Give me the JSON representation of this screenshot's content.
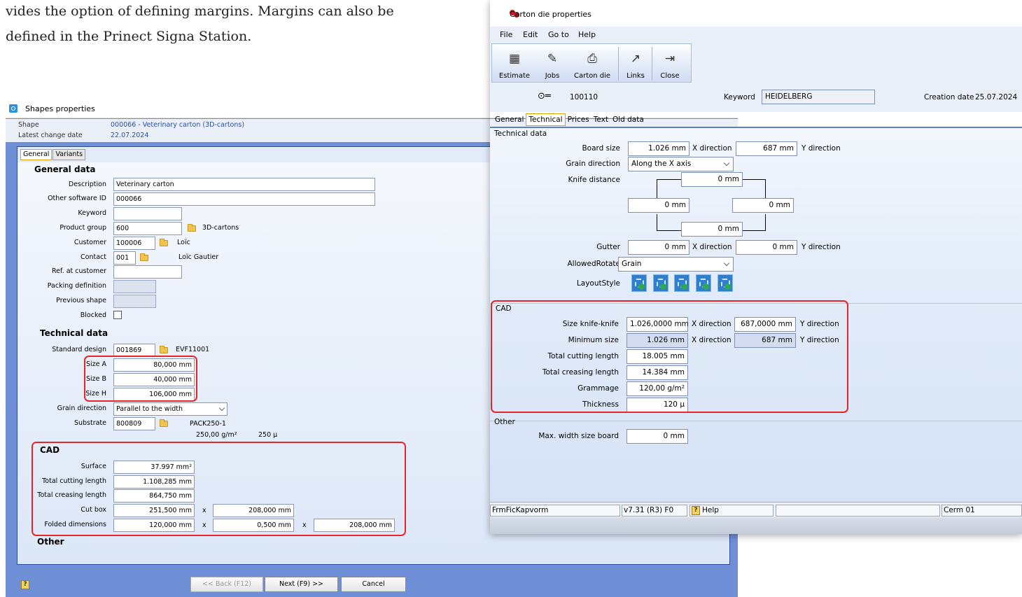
{
  "doc_text": {
    "line1": "vides the option of defining margins. Margins can also be",
    "line2": "defined in the Prinect Signa Station."
  },
  "shapes": {
    "title": "Shapes properties",
    "shape_label": "Shape",
    "shape_value": "000066 - Veterinary carton (3D-cartons)",
    "change_label": "Latest change date",
    "change_value": "22.07.2024",
    "tabs": [
      "General",
      "Variants"
    ],
    "general_heading": "General data",
    "description_label": "Description",
    "description_value": "Veterinary carton",
    "other_sw_label": "Other software ID",
    "other_sw_value": "000066",
    "keyword_label": "Keyword",
    "keyword_value": "",
    "product_group_label": "Product group",
    "product_group_value": "600",
    "product_group_name": "3D-cartons",
    "customer_label": "Customer",
    "customer_value": "100006",
    "customer_name": "Loïc",
    "contact_label": "Contact",
    "contact_value": "001",
    "contact_name": "Loïc Gautier",
    "ref_customer_label": "Ref. at customer",
    "packing_label": "Packing definition",
    "prev_shape_label": "Previous shape",
    "blocked_label": "Blocked",
    "technical_heading": "Technical data",
    "std_design_label": "Standard design",
    "std_design_value": "001869",
    "std_design_name": "EVF11001",
    "size_a_label": "Size A",
    "size_a_value": "80,000 mm",
    "size_b_label": "Size B",
    "size_b_value": "40,000 mm",
    "size_h_label": "Size H",
    "size_h_value": "106,000 mm",
    "grain_label": "Grain direction",
    "grain_value": "Parallel to the width",
    "substrate_label": "Substrate",
    "substrate_value": "800809",
    "substrate_name": "PACK250-1",
    "substrate_grammage": "250,00 g/m²",
    "substrate_thickness": "250 µ",
    "cad_heading": "CAD",
    "surface_label": "Surface",
    "surface_value": "37.997 mm²",
    "cutting_label": "Total cutting length",
    "cutting_value": "1.108,285 mm",
    "creasing_label": "Total creasing length",
    "creasing_value": "864,750 mm",
    "cutbox_label": "Cut box",
    "cutbox_x": "251,500 mm",
    "cutbox_y": "208,000 mm",
    "folded_label": "Folded dimensions",
    "folded_1": "120,000 mm",
    "folded_2": "0,500 mm",
    "folded_3": "208,000 mm",
    "times": "x",
    "other_heading": "Other",
    "help_glyph": "?",
    "back_button": "<< Back (F12)",
    "next_button": "Next (F9) >>",
    "cancel_button": "Cancel"
  },
  "carton": {
    "title": "Carton die properties",
    "menu": [
      "File",
      "Edit",
      "Go to",
      "Help"
    ],
    "toolbar": [
      {
        "label": "Estimate",
        "icon": "▦"
      },
      {
        "label": "Jobs",
        "icon": "✎"
      },
      {
        "label": "Carton die",
        "icon": "⎙"
      },
      {
        "label": "Links",
        "icon": "↗"
      },
      {
        "label": "Close",
        "icon": "⇥"
      }
    ],
    "key_glyph": "⊙═",
    "id_value": "100110",
    "keyword_label": "Keyword",
    "keyword_value": "HEIDELBERG",
    "creation_label": "Creation date",
    "creation_value": "25.07.2024",
    "tabs": [
      "General",
      "Technical",
      "Prices",
      "Text",
      "Old data"
    ],
    "technical_group": "Technical data",
    "board_size_label": "Board size",
    "board_x": "1.026 mm",
    "board_y": "687 mm",
    "x_direction": "X direction",
    "y_direction": "Y direction",
    "grain_label": "Grain direction",
    "grain_value": "Along the X axis",
    "knife_label": "Knife distance",
    "knife_top": "0 mm",
    "knife_left": "0 mm",
    "knife_right": "0 mm",
    "knife_bottom": "0 mm",
    "gutter_label": "Gutter",
    "gutter_x": "0 mm",
    "gutter_y": "0 mm",
    "rotate_label": "AllowedRotate",
    "rotate_value": "Grain",
    "layout_label": "LayoutStyle",
    "cad_group": "CAD",
    "kk_label": "Size knife-knife",
    "kk_x": "1.026,0000 mm",
    "kk_y": "687,0000 mm",
    "min_label": "Minimum size",
    "min_x": "1.026 mm",
    "min_y": "687 mm",
    "cutting_label": "Total cutting length",
    "cutting_value": "18.005 mm",
    "creasing_label": "Total creasing length",
    "creasing_value": "14.384 mm",
    "grammage_label": "Grammage",
    "grammage_value": "120,00 g/m²",
    "thickness_label": "Thickness",
    "thickness_value": "120 µ",
    "other_group": "Other",
    "maxwidth_label": "Max. width size board",
    "maxwidth_value": "0 mm",
    "status_form": "FrmFicKapvorm",
    "status_version": "v7.31 (R3) F0",
    "status_help": "Help",
    "status_help_glyph": "?",
    "status_user": "Cerm 01"
  }
}
